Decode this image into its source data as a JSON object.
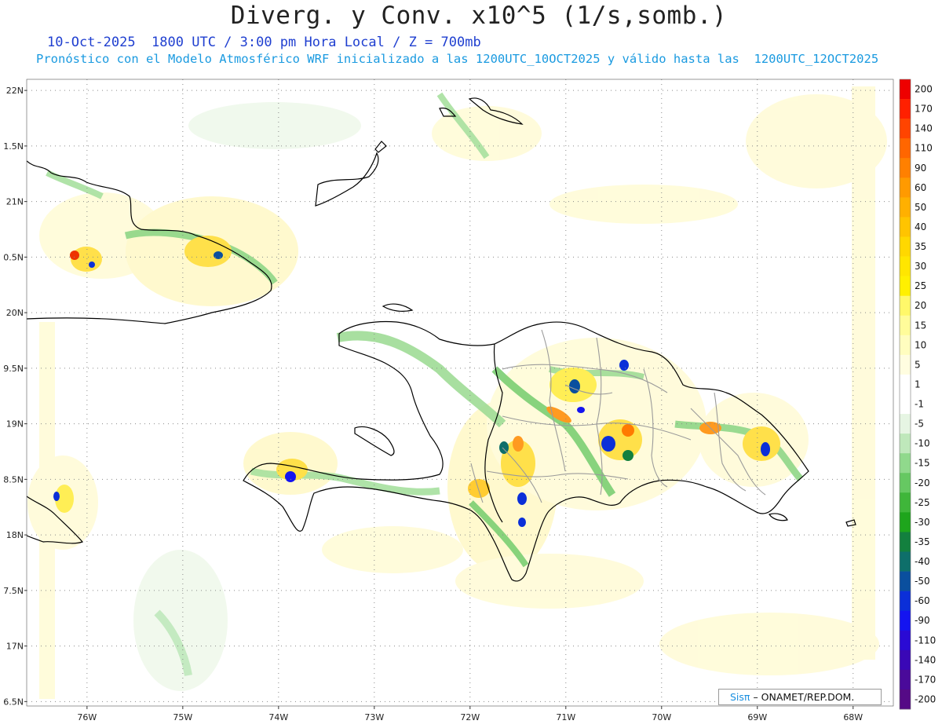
{
  "header": {
    "title": "Diverg. y Conv. x10^5 (1/s,somb.)",
    "subtitle_line1": "10-Oct-2025  1800 UTC / 3:00 pm Hora Local / Z = 700mb",
    "subtitle_line2": "Pronóstico con el Modelo Atmosférico WRF inicializado a las 1200UTC_10OCT2025 y válido hasta las  1200UTC_12OCT2025"
  },
  "axes": {
    "lat_labels": [
      "22N",
      "1.5N",
      "21N",
      "0.5N",
      "20N",
      "9.5N",
      "19N",
      "8.5N",
      "18N",
      "7.5N",
      "17N",
      "6.5N"
    ],
    "lon_labels": [
      "76W",
      "75W",
      "74W",
      "73W",
      "72W",
      "71W",
      "70W",
      "69W",
      "68W"
    ],
    "lon_values": [
      -76,
      -75,
      -74,
      -73,
      -72,
      -71,
      -70,
      -69,
      -68
    ],
    "lat_values": [
      22,
      21.5,
      21,
      20.5,
      20,
      19.5,
      19,
      18.5,
      18,
      17.5,
      17,
      16.5
    ],
    "extent": {
      "lon_min": -76.63,
      "lon_max": -67.58,
      "lat_min": 16.46,
      "lat_max": 22.1
    }
  },
  "colorbar": {
    "labels": [
      "200",
      "170",
      "140",
      "110",
      "90",
      "60",
      "50",
      "40",
      "35",
      "30",
      "25",
      "20",
      "15",
      "10",
      "5",
      "1",
      "-1",
      "-5",
      "-10",
      "-15",
      "-20",
      "-25",
      "-30",
      "-35",
      "-40",
      "-50",
      "-60",
      "-90",
      "-110",
      "-140",
      "-170",
      "-200"
    ],
    "colors": [
      "#ee0000",
      "#ff2000",
      "#ff4400",
      "#ff6600",
      "#ff8000",
      "#ff9a00",
      "#ffb000",
      "#ffc400",
      "#ffd800",
      "#ffe600",
      "#fff000",
      "#fff86a",
      "#fffc9a",
      "#fffdbf",
      "#fffde0",
      "#ffffff",
      "#ffffff",
      "#e6f5e3",
      "#bfe8bb",
      "#90d98c",
      "#66c862",
      "#3fb63a",
      "#1ea51c",
      "#13803e",
      "#0e6f6a",
      "#0a4f9e",
      "#0b2fd8",
      "#1414f0",
      "#2a0ad4",
      "#3a08b6",
      "#4a0a9a",
      "#550a86"
    ]
  },
  "credit": {
    "brand": "Sisπ",
    "text": "– ONAMET/REP.DOM."
  }
}
